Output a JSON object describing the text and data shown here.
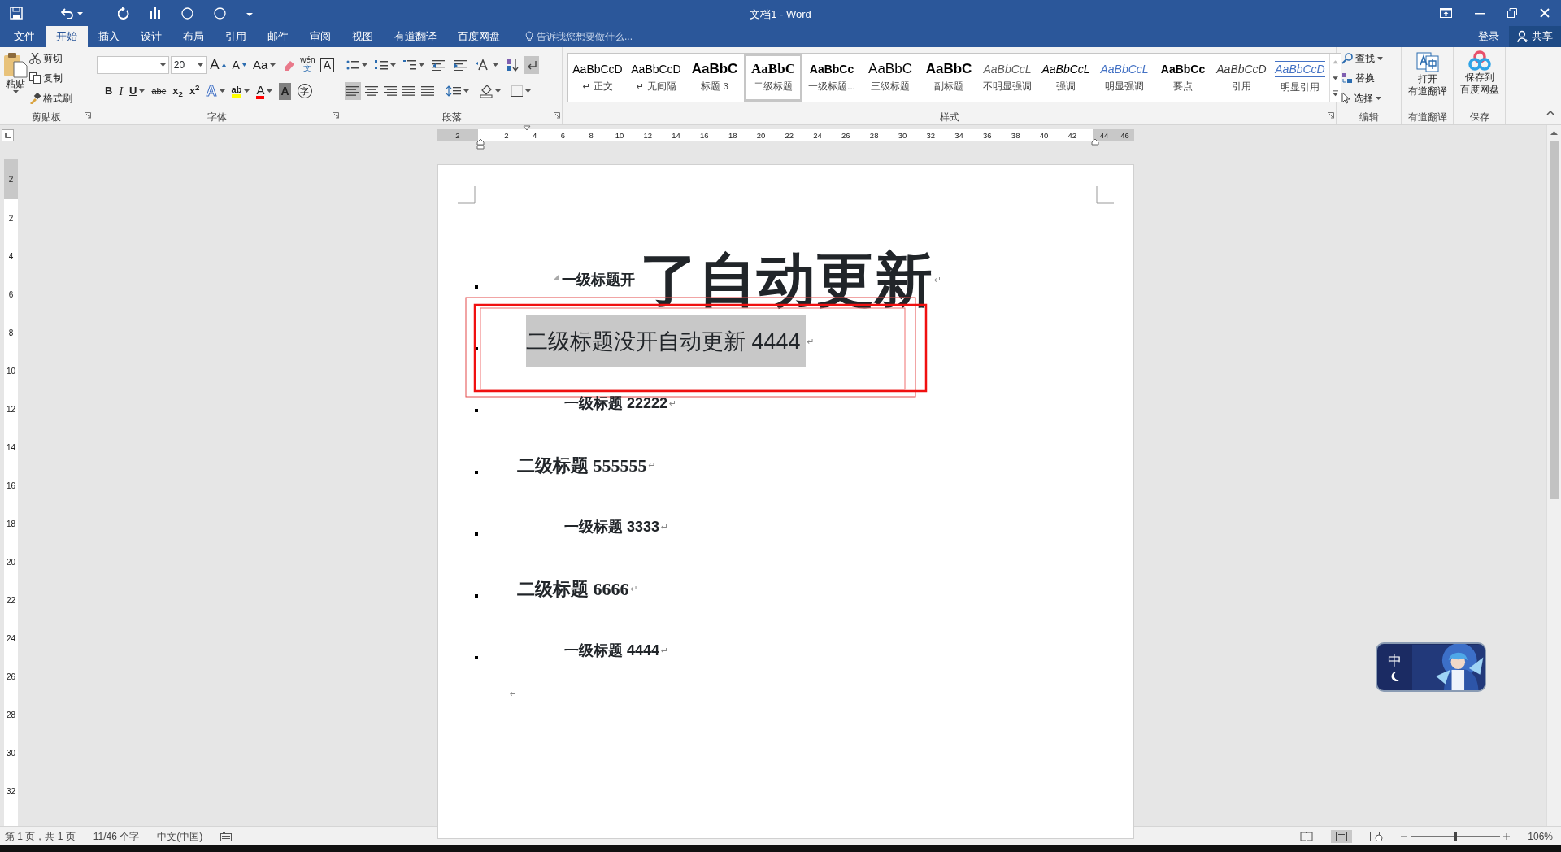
{
  "window": {
    "title": "文档1 - Word"
  },
  "account": {
    "sign_in": "登录",
    "share": "共享"
  },
  "tabs": [
    {
      "label": "文件",
      "selected": false
    },
    {
      "label": "开始",
      "selected": true
    },
    {
      "label": "插入",
      "selected": false
    },
    {
      "label": "设计",
      "selected": false
    },
    {
      "label": "布局",
      "selected": false
    },
    {
      "label": "引用",
      "selected": false
    },
    {
      "label": "邮件",
      "selected": false
    },
    {
      "label": "审阅",
      "selected": false
    },
    {
      "label": "视图",
      "selected": false
    },
    {
      "label": "有道翻译",
      "selected": false
    },
    {
      "label": "百度网盘",
      "selected": false
    }
  ],
  "tell_me": {
    "placeholder": "告诉我您想要做什么..."
  },
  "clipboard": {
    "paste": "粘贴",
    "cut": "剪切",
    "copy": "复制",
    "format_painter": "格式刷",
    "group": "剪贴板"
  },
  "font": {
    "size": "20",
    "group": "字体",
    "row1": [
      {
        "kind": "grow",
        "label": "A"
      },
      {
        "kind": "shrink",
        "label": "A"
      },
      {
        "kind": "case",
        "label": "Aa"
      },
      {
        "kind": "clear"
      },
      {
        "kind": "phonetic",
        "label": "wén",
        "sub": "文"
      },
      {
        "kind": "border",
        "label": "A"
      }
    ],
    "row2": [
      {
        "kind": "bold",
        "label": "B"
      },
      {
        "kind": "italic",
        "label": "I"
      },
      {
        "kind": "underline",
        "label": "U"
      },
      {
        "kind": "strike",
        "label": "abc"
      },
      {
        "kind": "script",
        "label": "x$_{2}$"
      },
      {
        "kind": "script",
        "label": "x$^{2}$"
      },
      {
        "kind": "effect",
        "label": "A"
      },
      {
        "kind": "highlight",
        "label": "ab",
        "color": "#ffff00"
      },
      {
        "kind": "fontcolor",
        "label": "A",
        "color": "#ff0000"
      },
      {
        "kind": "shading",
        "label": "A"
      },
      {
        "kind": "enclose",
        "label": "字"
      }
    ]
  },
  "paragraph": {
    "group": "段落",
    "show_marks": true,
    "alignments": [
      {
        "selected": true
      },
      {
        "selected": false
      },
      {
        "selected": false
      },
      {
        "selected": false
      },
      {
        "selected": false
      }
    ]
  },
  "styles": {
    "group": "样式",
    "items": [
      {
        "preview": "AaBbCcD",
        "name": "正文",
        "mark": "↵",
        "kind": "plain",
        "selected": false
      },
      {
        "preview": "AaBbCcD",
        "name": "无间隔",
        "mark": "↵",
        "kind": "plain",
        "selected": false
      },
      {
        "preview": "AaBbC",
        "name": "标题 3",
        "kind": "heavy",
        "selected": false
      },
      {
        "preview": "AaBbC",
        "name": "二级标题",
        "kind": "serif",
        "selected": true
      },
      {
        "preview": "AaBbCc",
        "name": "一级标题...",
        "kind": "bold",
        "selected": false
      },
      {
        "preview": "AaBbC",
        "name": "三级标题",
        "kind": "large",
        "selected": false
      },
      {
        "preview": "AaBbC",
        "name": "副标题",
        "kind": "heavy",
        "selected": false
      },
      {
        "preview": "AaBbCcL",
        "name": "不明显强调",
        "kind": "subtle",
        "selected": false
      },
      {
        "preview": "AaBbCcL",
        "name": "强调",
        "kind": "italic",
        "selected": false
      },
      {
        "preview": "AaBbCcL",
        "name": "明显强调",
        "kind": "intense",
        "selected": false
      },
      {
        "preview": "AaBbCc",
        "name": "要点",
        "kind": "bold",
        "selected": false
      },
      {
        "preview": "AaBbCcD",
        "name": "引用",
        "kind": "quote",
        "selected": false
      },
      {
        "preview": "AaBbCcD",
        "name": "明显引用",
        "kind": "intensequote",
        "selected": false
      }
    ]
  },
  "editing": {
    "find": "查找",
    "replace": "替换",
    "select": "选择",
    "group": "编辑"
  },
  "youdao": {
    "line_1": "打开",
    "line_2": "有道翻译",
    "group": "有道翻译"
  },
  "save": {
    "line_1": "保存到",
    "line_2": "百度网盘",
    "group": "保存"
  },
  "ruler": {
    "labels": [
      {
        "label": "2",
        "margin": true
      },
      {
        "label": "2",
        "margin": false
      },
      {
        "label": "4",
        "margin": false
      },
      {
        "label": "6",
        "margin": false
      },
      {
        "label": "8",
        "margin": false
      },
      {
        "label": "10",
        "margin": false
      },
      {
        "label": "12",
        "margin": false
      },
      {
        "label": "14",
        "margin": false
      },
      {
        "label": "16",
        "margin": false
      },
      {
        "label": "18",
        "margin": false
      },
      {
        "label": "20",
        "margin": false
      },
      {
        "label": "22",
        "margin": false
      },
      {
        "label": "24",
        "margin": false
      },
      {
        "label": "26",
        "margin": false
      },
      {
        "label": "28",
        "margin": false
      },
      {
        "label": "30",
        "margin": false
      },
      {
        "label": "32",
        "margin": false
      },
      {
        "label": "34",
        "margin": false
      },
      {
        "label": "36",
        "margin": false
      },
      {
        "label": "38",
        "margin": false
      },
      {
        "label": "40",
        "margin": false
      },
      {
        "label": "42",
        "margin": false
      },
      {
        "label": "44",
        "margin": true
      },
      {
        "label": "46",
        "margin": true
      }
    ]
  },
  "vertical_ruler": {
    "labels": [
      {
        "label": "2",
        "margin": true
      },
      {
        "label": "2",
        "margin": false
      },
      {
        "label": "4",
        "margin": false
      },
      {
        "label": "6",
        "margin": false
      },
      {
        "label": "8",
        "margin": false
      },
      {
        "label": "10",
        "margin": false
      },
      {
        "label": "12",
        "margin": false
      },
      {
        "label": "14",
        "margin": false
      },
      {
        "label": "16",
        "margin": false
      },
      {
        "label": "18",
        "margin": false
      },
      {
        "label": "20",
        "margin": false
      },
      {
        "label": "22",
        "margin": false
      },
      {
        "label": "24",
        "margin": false
      },
      {
        "label": "26",
        "margin": false
      },
      {
        "label": "28",
        "margin": false
      },
      {
        "label": "30",
        "margin": false
      },
      {
        "label": "32",
        "margin": false
      }
    ]
  },
  "document": {
    "lines": [
      {
        "kind": "heading1",
        "text": "一级标题开",
        "large_text": "了自动更新",
        "collapsible": true,
        "highlighted": false,
        "framed": false,
        "mark": "↵"
      },
      {
        "kind": "heading2-large",
        "text": "二级标题没开自动更新 4444",
        "highlighted": true,
        "framed": true,
        "mark": "↵"
      },
      {
        "kind": "heading1",
        "text": "一级标题 22222",
        "highlighted": false,
        "framed": false,
        "mark": "↵"
      },
      {
        "kind": "heading2",
        "text": "二级标题 555555",
        "highlighted": false,
        "framed": false,
        "mark": "↵"
      },
      {
        "kind": "heading1",
        "text": "一级标题 3333",
        "highlighted": false,
        "framed": false,
        "mark": "↵"
      },
      {
        "kind": "heading2",
        "text": "二级标题 6666",
        "highlighted": false,
        "framed": false,
        "mark": "↵"
      },
      {
        "kind": "heading1",
        "text": "一级标题 4444",
        "highlighted": false,
        "framed": false,
        "mark": "↵"
      }
    ],
    "end_mark": "↵"
  },
  "ime": {
    "label": "中"
  },
  "status_bar": {
    "page": "第 1 页，共 1 页",
    "words": "11/46 个字",
    "language": "中文(中国)",
    "zoom": {
      "level": 0.5,
      "reading": "106%"
    }
  }
}
